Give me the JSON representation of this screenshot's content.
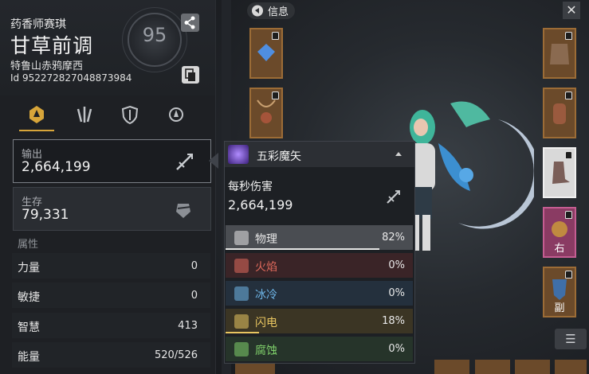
{
  "character": {
    "class_label": "药香师赛琪",
    "name": "甘草前调",
    "server": "特鲁山赤鸦摩西",
    "id_label": "Id 952272827048873984",
    "level": "95"
  },
  "tabs": [
    {
      "name": "tab-attack",
      "active": true
    },
    {
      "name": "tab-skill",
      "active": false
    },
    {
      "name": "tab-defense",
      "active": false
    },
    {
      "name": "tab-misc",
      "active": false
    }
  ],
  "output": {
    "label": "输出",
    "value": "2,664,199"
  },
  "survival": {
    "label": "生存",
    "value": "79,331"
  },
  "attributes": {
    "heading": "属性",
    "rows": [
      {
        "name": "力量",
        "value": "0"
      },
      {
        "name": "敏捷",
        "value": "0"
      },
      {
        "name": "智慧",
        "value": "413"
      },
      {
        "name": "能量",
        "value": "520/526"
      }
    ]
  },
  "scene": {
    "info_label": "信息",
    "close_label": "✕",
    "list_label": "☰",
    "right_slot_tags": [
      "右",
      "副"
    ]
  },
  "popup": {
    "skill_name": "五彩魔矢",
    "dps_label": "每秒伤害",
    "dps_value": "2,664,199",
    "elements": [
      {
        "name": "物理",
        "percent": "82%",
        "fraction": 0.82,
        "color": "#e6e6e6",
        "bg": "#4a4d52"
      },
      {
        "name": "火焰",
        "percent": "0%",
        "fraction": 0.0,
        "color": "#e06a5c",
        "bg": "#3a2427"
      },
      {
        "name": "冰冷",
        "percent": "0%",
        "fraction": 0.0,
        "color": "#6fb6e8",
        "bg": "#24303d"
      },
      {
        "name": "闪电",
        "percent": "18%",
        "fraction": 0.18,
        "color": "#e8c560",
        "bg": "#3b3524"
      },
      {
        "name": "腐蚀",
        "percent": "0%",
        "fraction": 0.0,
        "color": "#7fcf6a",
        "bg": "#26342a"
      }
    ]
  },
  "colors": {
    "accent": "#d7a53a",
    "slot_orange": "#9c6c36",
    "slot_pink": "#c55d92"
  }
}
